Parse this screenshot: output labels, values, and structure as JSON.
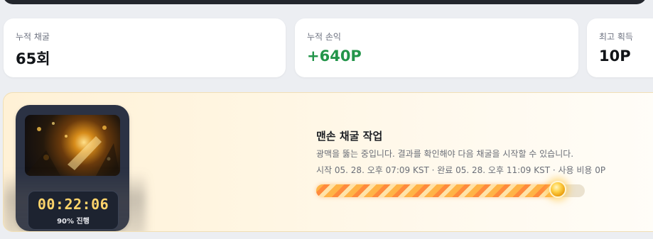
{
  "stats": [
    {
      "label": "누적 채굴",
      "value": "65회"
    },
    {
      "label": "누적 손익",
      "value": "+640P"
    },
    {
      "label": "최고 획득",
      "value": "10P"
    }
  ],
  "mining": {
    "timer": "00:22:06",
    "progress_text": "90% 진행",
    "progress": 0.9,
    "title": "맨손 채굴 작업",
    "description": "광맥을 뚫는 중입니다. 결과를 확인해야 다음 채굴을 시작할 수 있습니다.",
    "meta": "시작 05. 28. 오후 07:09 KST · 완료 05. 28. 오후 11:09 KST · 사용 비용 0P"
  },
  "colors": {
    "profit_green": "#23954a",
    "timer_gold": "#ffd46b",
    "progress_orange": "#ff8a3c"
  },
  "icons": {
    "thumbnail": "gold-ore-cave-image",
    "knob": "progress-knob-icon"
  }
}
